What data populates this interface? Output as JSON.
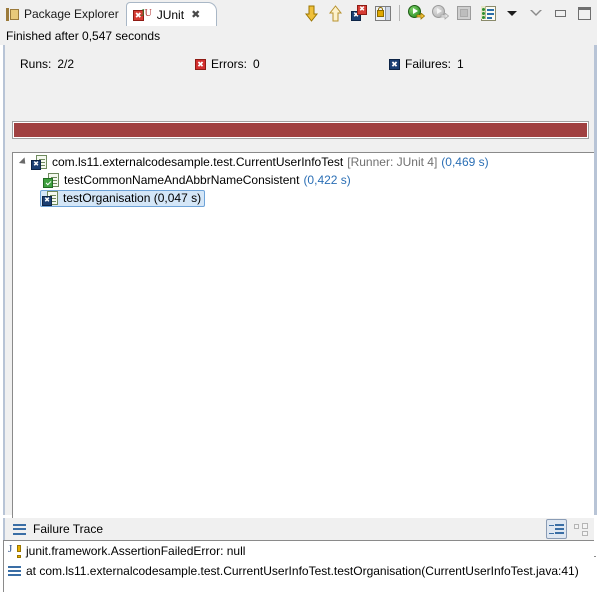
{
  "tabs": [
    {
      "label": "Package Explorer",
      "icon": "package-explorer-icon",
      "active": false,
      "closable": false
    },
    {
      "label": "JUnit",
      "icon": "junit-icon",
      "active": true,
      "closable": true,
      "close_glyph": "✖"
    }
  ],
  "toolbar": {
    "items": [
      {
        "name": "next-failed-test-button",
        "icon": "arrow-down-icon",
        "title": "Next Failed Test"
      },
      {
        "name": "previous-failed-test-button",
        "icon": "arrow-up-icon",
        "title": "Previous Failed Test"
      },
      {
        "name": "show-failures-only-button",
        "icon": "failures-only-icon",
        "title": "Show Failures Only"
      },
      {
        "name": "scroll-lock-button",
        "icon": "scroll-lock-icon",
        "title": "Scroll Lock"
      },
      {
        "name": "rerun-test-button",
        "icon": "rerun-icon",
        "title": "Rerun Test"
      },
      {
        "name": "rerun-failed-first-button",
        "icon": "rerun-failed-icon",
        "title": "Rerun Test - Failures First"
      },
      {
        "name": "stop-button",
        "icon": "stop-icon",
        "title": "Stop JUnit Test Run"
      },
      {
        "name": "test-run-history-button",
        "icon": "history-icon",
        "title": "Test Run History"
      },
      {
        "name": "view-menu-button",
        "icon": "chevron-down-icon",
        "title": "View Menu"
      },
      {
        "name": "minimize-chevron-button",
        "icon": "minimize-chevron-icon",
        "title": "Restore"
      },
      {
        "name": "minimize-button",
        "icon": "minimize-icon",
        "title": "Minimize"
      },
      {
        "name": "maximize-button",
        "icon": "maximize-icon",
        "title": "Maximize"
      }
    ]
  },
  "status": {
    "text": "Finished after 0,547 seconds"
  },
  "counters": {
    "runs": {
      "label": "Runs:",
      "value": "2/2"
    },
    "errors": {
      "label": "Errors:",
      "value": "0",
      "icon": "error-square-icon",
      "color": "#d32f2f",
      "glyph": "✖"
    },
    "failures": {
      "label": "Failures:",
      "value": "1",
      "icon": "failure-square-icon",
      "color": "#1b3f73",
      "glyph": "✖"
    }
  },
  "progress": {
    "state": "failed",
    "color": "#a04040",
    "percent": 100
  },
  "tree": {
    "nodes": [
      {
        "level": 0,
        "expanded": true,
        "expander_glyph": "▼",
        "icon": "test-class-failed-icon",
        "badge": "blue",
        "badge_glyph": "✖",
        "label": "com.ls11.externalcodesample.test.CurrentUserInfoTest",
        "runner": "[Runner: JUnit 4]",
        "time": "(0,469 s)",
        "selected": false
      },
      {
        "level": 1,
        "expanded": false,
        "icon": "test-method-passed-icon",
        "badge": "green",
        "badge_glyph": "✓",
        "label": "testCommonNameAndAbbrNameConsistent",
        "runner": "",
        "time": "(0,422 s)",
        "selected": false
      },
      {
        "level": 1,
        "expanded": false,
        "icon": "test-method-failed-icon",
        "badge": "blue",
        "badge_glyph": "✖",
        "label": "testOrganisation (0,047 s)",
        "runner": "",
        "time": "",
        "selected": true
      }
    ]
  },
  "failure_trace": {
    "title": "Failure Trace",
    "title_icon": "stack-lines-icon",
    "tools": [
      {
        "name": "filter-stack-trace-button",
        "icon": "filter-stack-trace-icon",
        "pressed": true
      },
      {
        "name": "compare-result-button",
        "icon": "compare-layout-icon",
        "pressed": false
      }
    ],
    "rows": [
      {
        "icon": "exception-icon",
        "text": "junit.framework.AssertionFailedError: null"
      },
      {
        "icon": "stack-frame-icon",
        "text": "at com.ls11.externalcodesample.test.CurrentUserInfoTest.testOrganisation(CurrentUserInfoTest.java:41)"
      }
    ]
  }
}
